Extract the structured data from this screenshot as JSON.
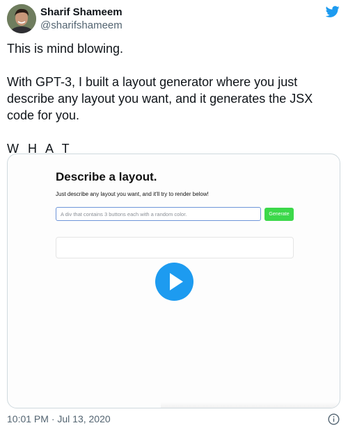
{
  "author": {
    "name": "Sharif Shameem",
    "handle": "@sharifshameem"
  },
  "tweet": {
    "line1": "This is mind blowing.",
    "line2": "With GPT-3, I built a layout generator where you just describe any layout you want, and it generates the JSX code for you.",
    "line3": "W H A T"
  },
  "media": {
    "title": "Describe a layout.",
    "subtitle": "Just describe any layout you want, and it'll try to render below!",
    "input_value": "A div that contains 3 buttons each with a random color.",
    "button_label": "Generate"
  },
  "footer": {
    "timestamp": "10:01 PM · Jul 13, 2020"
  },
  "colors": {
    "twitter_blue": "#1d9bf0",
    "generate_green": "#3cd84a",
    "input_border": "#6e95d8"
  },
  "icons": [
    "twitter-bird-icon",
    "play-icon",
    "info-icon"
  ]
}
